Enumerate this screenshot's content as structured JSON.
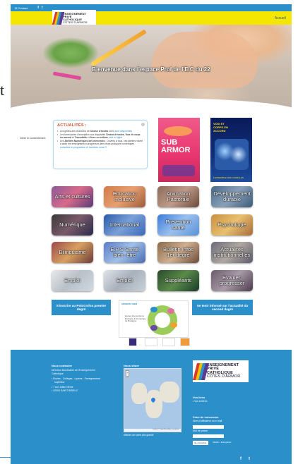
{
  "topbar": {
    "contact": "✉ Contact",
    "facebook": "f",
    "twitter": "t"
  },
  "logo": {
    "line1": "ENSEIGNEMENT",
    "line2": "PRIVÉ",
    "line3": "CATHOLIQUE",
    "line4": "CÔTES D'ARMOR"
  },
  "nav": {
    "accueil": "Accueil"
  },
  "hero": {
    "title": "Bienvenue dans l'espace Prof de l'E.C du 22",
    "stray": "t"
  },
  "consent": "Gérer le consentement",
  "news": {
    "title": "ACTUALITÉS :",
    "items": [
      [
        "Les grilles des chansons de ",
        "Chœur d'écoles",
        " 2023 ",
        "sont disponibles"
      ],
      [
        "Les formulaires d'inscription aux dispositifs ",
        "Chœur d'écoles",
        ", ",
        "Voix et corps en accord",
        " et ",
        "Traverfaits",
        " et ",
        "Avec ou culture",
        " sont en ligne"
      ],
      [
        "Les ",
        "Ateliers Numériques des mercredis",
        " : Ouverts à tous, ces ateliers visent à aider les enseignants à progresser dans leurs pratiques numériques. ",
        "consultez le programme et inscrivez-vous !!!"
      ]
    ]
  },
  "poster1": {
    "big": "SUB ARMOR"
  },
  "poster2": {
    "title": "VOIX ET CORPS EN ACCORD",
    "bottom": "L'ENSEMBLE DES CHORALES"
  },
  "tiles": [
    {
      "label": "Arts et cultures"
    },
    {
      "label": "Education inclusive"
    },
    {
      "label": "Animation Pastorale"
    },
    {
      "label": "Développement durable"
    },
    {
      "label": "Numérique"
    },
    {
      "label": "International"
    },
    {
      "label": "Prévention santé"
    },
    {
      "label": "Psychologie"
    },
    {
      "label": "Bilinguisme"
    },
    {
      "label": "E.P.S Santé bien- être"
    },
    {
      "label": "Bulletin Infos 1er degré"
    },
    {
      "label": "Actualités institutionnelles"
    },
    {
      "label": "Emploi"
    },
    {
      "label": "Emploi"
    },
    {
      "label": "Suppléants"
    },
    {
      "label": "Evaluer, progresser"
    }
  ],
  "buttons": {
    "left": "S'inscrire au Point Infos premier degré",
    "right": "Se tenir informé sur l'actualité du second degré"
  },
  "infographic": {
    "heading": "ARDENTA WEB",
    "text": "Ecoles Interventions Ecologie & Numérique de Bretagne"
  },
  "footer": {
    "contact_title": "Nous contacter",
    "contact_lines": [
      "Direction Diocésaine de l'Enseignement",
      "Catholique",
      "• Écoles - Collèges - Lycées - Enseignement",
      "supérieur",
      "• 7 rue Julien Nême",
      "• 22000 SAINT BRIEUC"
    ],
    "map_title": "Nous situer",
    "map_attr": "Leaflet | © OpenStreetMap contributors",
    "map_link": "Afficher une carte plus grande",
    "vos_liens_title": "Vos liens",
    "vos_liens_item": "• Vos entrées",
    "login_title": "Zone de connexion",
    "login_user_label": "Nom d'utilisateur ou e-mail",
    "login_pass_label": "Mot de passe",
    "login_button": "Se connecter",
    "remember": "Valider • Enregistrer"
  },
  "colors": {
    "blue": "#2b8fca",
    "yellow": "#f4e600"
  }
}
